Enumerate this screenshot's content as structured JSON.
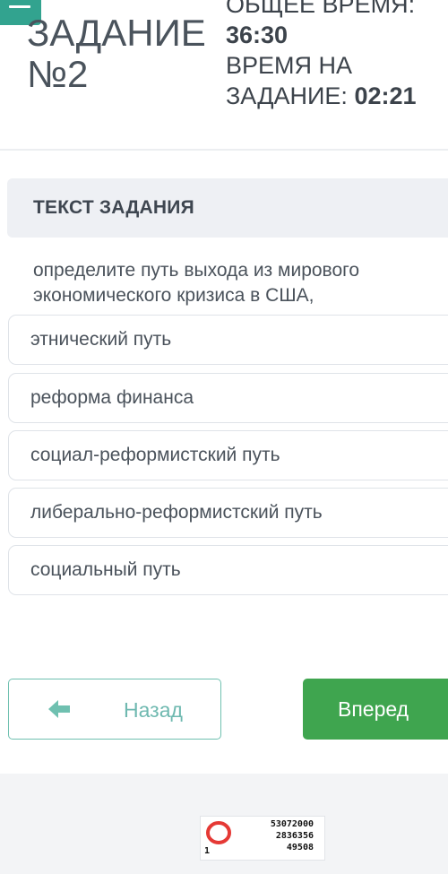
{
  "header": {
    "task_title": "ЗАДАНИЕ №2",
    "total_time_label": "ОБЩЕЕ ВРЕМЯ:",
    "total_time_value": "36:30",
    "task_time_label": "ВРЕМЯ НА ЗАДАНИЕ:",
    "task_time_value": "02:21"
  },
  "task": {
    "section_label": "ТЕКСТ ЗАДАНИЯ",
    "question": "определите путь выхода из мирового экономического кризиса в США,"
  },
  "options": [
    "этнический путь",
    "реформа финанса",
    "социал-реформистский путь",
    "либерально-реформистский путь",
    "социальный путь"
  ],
  "nav": {
    "back_label": "Назад",
    "next_label": "Вперед"
  },
  "footer_image": {
    "small_number": "1",
    "numbers": [
      "53072000",
      "2836356",
      "49508"
    ]
  },
  "colors": {
    "accent_teal": "#32a38f",
    "next_green": "#3fa54f",
    "back_text": "#6fb9b0",
    "ring_red": "#e53935"
  },
  "icons": {
    "menu": "hamburger-icon",
    "back": "arrow-left-icon"
  }
}
